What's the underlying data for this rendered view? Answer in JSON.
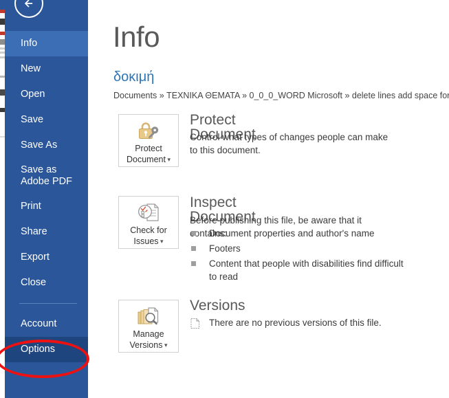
{
  "app": {
    "accent_blue": "#2b579a",
    "selected_blue": "#3b6eb5",
    "active_blue": "#1f457e",
    "annotation_color": "#ee1111",
    "doc_link_color": "#2e75b6",
    "heading_gray": "#595959"
  },
  "sidebar": {
    "back_button": {
      "name": "back-arrow-button",
      "icon": "arrow-left-icon"
    },
    "items": [
      {
        "label": "Info",
        "state": "selected"
      },
      {
        "label": "New",
        "state": "normal"
      },
      {
        "label": "Open",
        "state": "normal"
      },
      {
        "label": "Save",
        "state": "normal"
      },
      {
        "label": "Save As",
        "state": "normal"
      },
      {
        "label": "Save as Adobe PDF",
        "state": "normal"
      },
      {
        "label": "Print",
        "state": "normal"
      },
      {
        "label": "Share",
        "state": "normal"
      },
      {
        "label": "Export",
        "state": "normal"
      },
      {
        "label": "Close",
        "state": "normal"
      },
      {
        "label": "Account",
        "state": "normal"
      },
      {
        "label": "Options",
        "state": "active"
      }
    ]
  },
  "annotation": {
    "target": "Options",
    "shape": "red-ellipse"
  },
  "header": {
    "title": "Info",
    "document_name": "δοκιμή",
    "breadcrumb": "Documents » ΤΕΧΝΙΚΑ ΘΕΜΑΤΑ » 0_0_0_WORD Microsoft » delete lines add space for soluti"
  },
  "sections": [
    {
      "key": "protect",
      "title": "Protect Document",
      "button_label_line1": "Protect",
      "button_label_line2": "Document",
      "button_icon": "lock-and-key-icon",
      "has_caret": true,
      "description": "Control what types of changes people can make to this document.",
      "bullets": []
    },
    {
      "key": "inspect",
      "title": "Inspect Document",
      "button_label_line1": "Check for",
      "button_label_line2": "Issues",
      "button_icon": "document-checklist-icon",
      "has_caret": true,
      "description": "Before publishing this file, be aware that it contains:",
      "bullets": [
        "Document properties and author's name",
        "Footers",
        "Content that people with disabilities find difficult to read"
      ]
    },
    {
      "key": "versions",
      "title": "Versions",
      "button_label_line1": "Manage",
      "button_label_line2": "Versions",
      "button_icon": "documents-magnifier-icon",
      "has_caret": true,
      "description": "There are no previous versions of this file.",
      "bullets": []
    }
  ]
}
